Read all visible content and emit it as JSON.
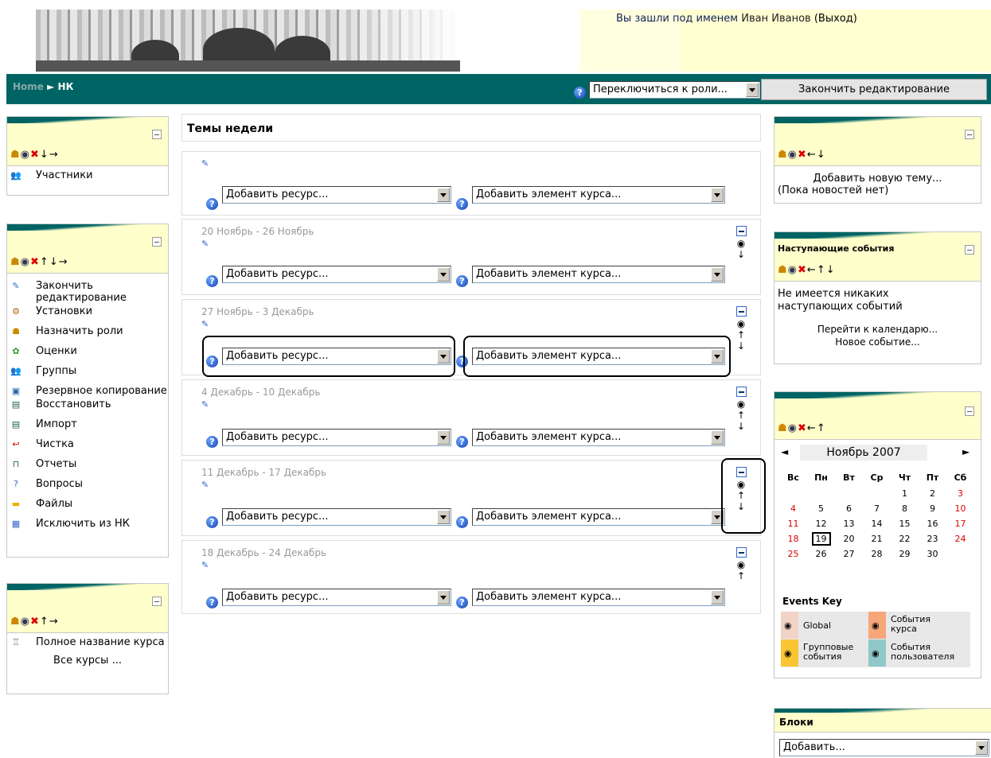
{
  "header": {
    "login_prefix": "Вы зашли под именем",
    "user": "Иван Иванов",
    "logout": "(Выход)"
  },
  "nav": {
    "home": "Home",
    "sep": "►",
    "course": "НК",
    "role_select": "Переключиться к роли...",
    "end_edit": "Закончить редактирование"
  },
  "left_blocks": {
    "participants": {
      "items": [
        "Участники"
      ]
    },
    "admin": {
      "items": [
        "Закончить редактирование",
        "Установки",
        "Назначить роли",
        "Оценки",
        "Группы",
        "Резервное копирование",
        "Восстановить",
        "Импорт",
        "Чистка",
        "Отчеты",
        "Вопросы",
        "Файлы",
        "Исключить из НК"
      ]
    },
    "course_summary": {
      "item": "Полное название курса",
      "all_courses": "Все курсы ..."
    }
  },
  "main": {
    "title": "Темы недели",
    "add_resource": "Добавить ресурс...",
    "add_activity": "Добавить элемент курса...",
    "sections": [
      {
        "dates": ""
      },
      {
        "dates": "20 Ноябрь - 26 Ноябрь"
      },
      {
        "dates": "27 Ноябрь - 3 Декабрь"
      },
      {
        "dates": "4 Декабрь - 10 Декабрь"
      },
      {
        "dates": "11 Декабрь - 17 Декабрь"
      },
      {
        "dates": "18 Декабрь - 24 Декабрь"
      }
    ]
  },
  "right_blocks": {
    "news": {
      "add_topic": "Добавить новую тему...",
      "empty": "(Пока новостей нет)"
    },
    "upcoming": {
      "title": "Наступающие события",
      "empty": "Не имеется никаких наступающих событий",
      "goto_calendar": "Перейти к календарю...",
      "new_event": "Новое событие..."
    },
    "calendar": {
      "month": "Ноябрь 2007",
      "prev": "◄",
      "next": "►",
      "weekdays": [
        "Вс",
        "Пн",
        "Вт",
        "Ср",
        "Чт",
        "Пт",
        "Сб"
      ],
      "weeks": [
        [
          "",
          "",
          "",
          "",
          "1",
          "2",
          "3"
        ],
        [
          "4",
          "5",
          "6",
          "7",
          "8",
          "9",
          "10"
        ],
        [
          "11",
          "12",
          "13",
          "14",
          "15",
          "16",
          "17"
        ],
        [
          "18",
          "19",
          "20",
          "21",
          "22",
          "23",
          "24"
        ],
        [
          "25",
          "26",
          "27",
          "28",
          "29",
          "30",
          ""
        ]
      ],
      "today": "19",
      "events_key_title": "Events Key",
      "keys": [
        {
          "label": "Global",
          "color": "#f2d3c8"
        },
        {
          "label": "События курса",
          "color": "#f7a67a"
        },
        {
          "label": "Групповые события",
          "color": "#f9c532"
        },
        {
          "label": "События пользователя",
          "color": "#90c8c8"
        }
      ]
    },
    "blocks": {
      "title": "Блоки",
      "add": "Добавить..."
    }
  },
  "colors": {
    "nav_bg": "#006464",
    "block_head": "#ffffcc",
    "weekend": "#dd0000"
  }
}
